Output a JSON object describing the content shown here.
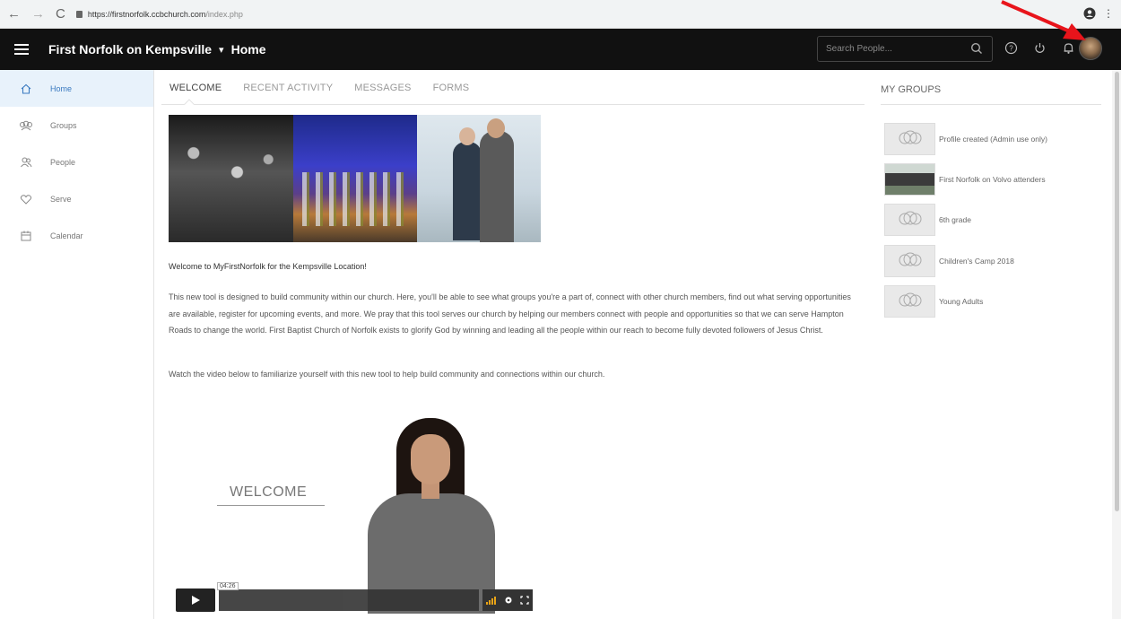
{
  "browser": {
    "url_host": "https://firstnorfolk.ccbchurch.com",
    "url_path": "/index.php"
  },
  "header": {
    "site_title": "First Norfolk on Kempsville",
    "caret": "▾",
    "page_title": "Home",
    "search_placeholder": "Search People..."
  },
  "sidebar": {
    "items": [
      {
        "label": "Home",
        "icon": "home-icon",
        "active": true
      },
      {
        "label": "Groups",
        "icon": "groups-icon",
        "active": false
      },
      {
        "label": "People",
        "icon": "people-icon",
        "active": false
      },
      {
        "label": "Serve",
        "icon": "heart-icon",
        "active": false
      },
      {
        "label": "Calendar",
        "icon": "calendar-icon",
        "active": false
      }
    ]
  },
  "tabs": [
    {
      "label": "WELCOME",
      "active": true
    },
    {
      "label": "RECENT ACTIVITY",
      "active": false
    },
    {
      "label": "MESSAGES",
      "active": false
    },
    {
      "label": "FORMS",
      "active": false
    }
  ],
  "main": {
    "intro_title": "Welcome to MyFirstNorfolk for the Kempsville Location!",
    "intro_text": "This new tool is designed to build community within our church. Here, you'll be able to see what groups you're a part of, connect with other church members, find out what serving opportunities are available, register for upcoming events, and more. We pray that this tool serves our church by helping our members connect with people and opportunities so that we can serve Hampton Roads to change the world. First Baptist Church of Norfolk exists to glorify God by winning and leading all the people within our reach to become fully devoted followers of Jesus Christ.",
    "watch_text": "Watch the video below to familiarize yourself with this new tool to help build community and connections within our church.",
    "video_overlay": "WELCOME",
    "video_time": "04:26"
  },
  "my_groups": {
    "title": "MY GROUPS",
    "items": [
      {
        "name": "Profile created (Admin use only)",
        "thumb": "default"
      },
      {
        "name": "First Norfolk on Volvo attenders",
        "thumb": "photo"
      },
      {
        "name": "6th grade",
        "thumb": "default"
      },
      {
        "name": "Children's Camp 2018",
        "thumb": "default"
      },
      {
        "name": "Young Adults",
        "thumb": "default"
      }
    ]
  },
  "colors": {
    "header_bg": "#111111",
    "active_blue": "#3a7ac0",
    "annotation_red": "#e8141b"
  }
}
